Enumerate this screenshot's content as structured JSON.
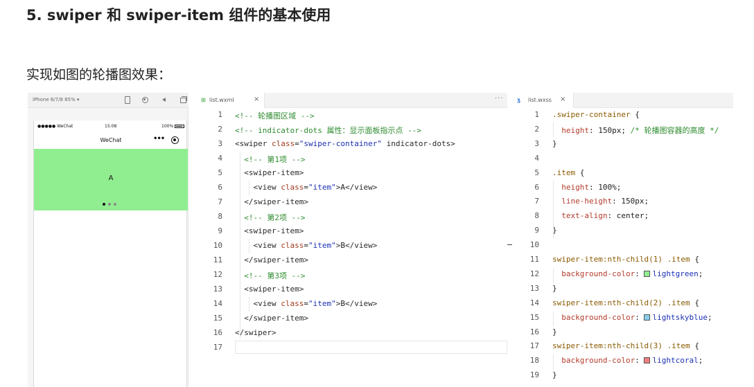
{
  "heading": "5. swiper 和 swiper-item 组件的基本使用",
  "subheading": "实现如图的轮播图效果：",
  "simulator": {
    "device": "iPhone 6/7/8 85% ▾",
    "status_bar": {
      "carrier": "●●●●● WeChat",
      "time": "15:08",
      "battery": "100%"
    },
    "nav_title": "WeChat",
    "menu": "•••",
    "swiper_text": "A",
    "swiper_color": "#90ee90",
    "dot_active_color": "#111111",
    "dot_inactive_color": "#8a8a8a",
    "icons": [
      "phone-icon",
      "record-icon",
      "sound-icon",
      "copy-icon",
      "more-icon"
    ]
  },
  "wxml": {
    "tab_label": "list.wxml",
    "close": "×",
    "more": "···",
    "lines": [
      {
        "n": "1",
        "code": "<!-- 轮播图区域 -->"
      },
      {
        "n": "2",
        "code": "<!-- indicator-dots 属性：显示面板指示点 -->"
      },
      {
        "n": "3",
        "code": "<swiper class=\"swiper-container\" indicator-dots>"
      },
      {
        "n": "4",
        "code": "  <!-- 第1项 -->"
      },
      {
        "n": "5",
        "code": "  <swiper-item>"
      },
      {
        "n": "6",
        "code": "    <view class=\"item\">A</view>"
      },
      {
        "n": "7",
        "code": "  </swiper-item>"
      },
      {
        "n": "8",
        "code": "  <!-- 第2项 -->"
      },
      {
        "n": "9",
        "code": "  <swiper-item>"
      },
      {
        "n": "10",
        "code": "    <view class=\"item\">B</view>"
      },
      {
        "n": "11",
        "code": "  </swiper-item>"
      },
      {
        "n": "12",
        "code": "  <!-- 第3项 -->"
      },
      {
        "n": "13",
        "code": "  <swiper-item>"
      },
      {
        "n": "14",
        "code": "    <view class=\"item\">B</view>"
      },
      {
        "n": "15",
        "code": "  </swiper-item>"
      },
      {
        "n": "16",
        "code": "</swiper>"
      },
      {
        "n": "17",
        "code": ""
      }
    ]
  },
  "wxss": {
    "tab_label": "list.wxss",
    "close": "×",
    "lines": [
      {
        "n": "1",
        "code": ".swiper-container {"
      },
      {
        "n": "2",
        "code": "  height: 150px; /* 轮播图容器的高度 */"
      },
      {
        "n": "3",
        "code": "}"
      },
      {
        "n": "4",
        "code": ""
      },
      {
        "n": "5",
        "code": ".item {"
      },
      {
        "n": "6",
        "code": "  height: 100%;"
      },
      {
        "n": "7",
        "code": "  line-height: 150px;"
      },
      {
        "n": "8",
        "code": "  text-align: center;"
      },
      {
        "n": "9",
        "code": "}"
      },
      {
        "n": "10",
        "code": ""
      },
      {
        "n": "11",
        "code": "swiper-item:nth-child(1) .item {"
      },
      {
        "n": "12",
        "code": "  background-color: ",
        "swatch": "#90ee90",
        "color_word": "lightgreen",
        "tail": ";"
      },
      {
        "n": "13",
        "code": "}"
      },
      {
        "n": "14",
        "code": "swiper-item:nth-child(2) .item {"
      },
      {
        "n": "15",
        "code": "  background-color: ",
        "swatch": "#87ceeb",
        "color_word": "lightskyblue",
        "tail": ";"
      },
      {
        "n": "16",
        "code": "}"
      },
      {
        "n": "17",
        "code": "swiper-item:nth-child(3) .item {"
      },
      {
        "n": "18",
        "code": "  background-color: ",
        "swatch": "#f08080",
        "color_word": "lightcoral",
        "tail": ";"
      },
      {
        "n": "19",
        "code": "}"
      }
    ]
  },
  "colors": {
    "comment": "#2e8b2e",
    "tag": "#2a2a2a",
    "attr": "#a33a1f",
    "string": "#1a2fb3",
    "selector": "#8a5a00",
    "property": "#b23b2b",
    "text": "#222222"
  }
}
